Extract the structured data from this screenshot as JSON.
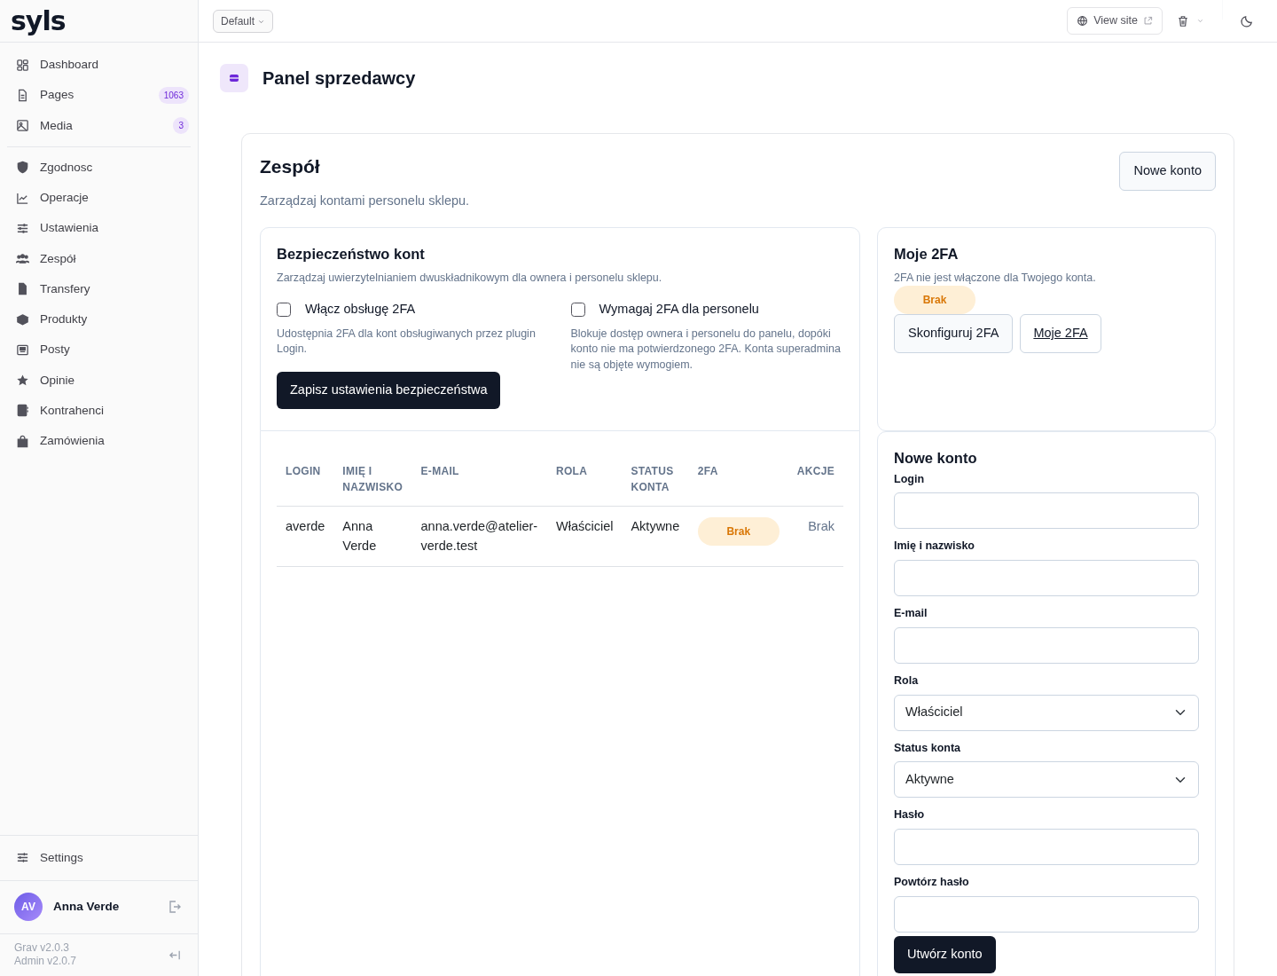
{
  "sidebar": {
    "logo": "syls",
    "items": [
      {
        "label": "Dashboard",
        "selected": false
      },
      {
        "label": "Pages",
        "badge": "1063",
        "selected": false
      },
      {
        "label": "Media",
        "badge": "3",
        "selected": false
      }
    ],
    "plugin_items": [
      {
        "label": "Zgodnosc"
      },
      {
        "label": "Operacje"
      },
      {
        "label": "Ustawienia"
      },
      {
        "label": "Zespół"
      },
      {
        "label": "Transfery"
      },
      {
        "label": "Produkty"
      },
      {
        "label": "Posty"
      },
      {
        "label": "Opinie"
      },
      {
        "label": "Kontrahenci"
      },
      {
        "label": "Zamówienia"
      }
    ],
    "settings": "Settings",
    "user": {
      "initials": "AV",
      "name": "Anna Verde"
    },
    "versions": [
      "Grav v2.0.3",
      "Admin v2.0.7"
    ]
  },
  "topbar": {
    "environment": "Default",
    "view_site": "View site"
  },
  "page": {
    "title": "Panel sprzedawcy"
  },
  "team": {
    "title": "Zespół",
    "subtitle": "Zarządzaj kontami personelu sklepu.",
    "new_button": "Nowe konto"
  },
  "security": {
    "title": "Bezpieczeństwo kont",
    "description": "Zarządzaj uwierzytelnianiem dwuskładnikowym dla ownera i personelu sklepu.",
    "options": [
      {
        "label": "Włącz obsługę 2FA",
        "checked": false,
        "help": "Udostępnia 2FA dla kont obsługiwanych przez plugin Login."
      },
      {
        "label": "Wymagaj 2FA dla personelu",
        "checked": false,
        "help": "Blokuje dostęp ownera i personelu do panelu, dopóki konto nie ma potwierdzonego 2FA. Konta superadmina nie są objęte wymogiem."
      }
    ],
    "save_button": "Zapisz ustawienia bezpieczeństwa"
  },
  "table": {
    "columns": [
      "LOGIN",
      "IMIĘ I NAZWISKO",
      "E-MAIL",
      "ROLA",
      "STATUS KONTA",
      "2FA",
      "AKCJE"
    ],
    "rows": [
      {
        "login": "averde",
        "name": "Anna Verde",
        "email": "anna.verde@atelier-verde.test",
        "role": "Właściciel",
        "status": "Aktywne",
        "twofa": "Brak",
        "actions": "Brak"
      }
    ]
  },
  "my2fa": {
    "title": "Moje 2FA",
    "text": "2FA nie jest włączone dla Twojego konta.",
    "badge": "Brak",
    "buttons": [
      {
        "label": "Skonfiguruj 2FA",
        "kind": "button"
      },
      {
        "label": "Moje 2FA",
        "kind": "link"
      }
    ]
  },
  "new_account": {
    "title": "Nowe konto",
    "fields": [
      {
        "label": "Login",
        "kind": "input"
      },
      {
        "label": "Imię i nazwisko",
        "kind": "input"
      },
      {
        "label": "E-mail",
        "kind": "input"
      },
      {
        "label": "Rola",
        "kind": "select",
        "value": "Właściciel"
      },
      {
        "label": "Status konta",
        "kind": "select",
        "value": "Aktywne"
      },
      {
        "label": "Hasło",
        "kind": "password"
      },
      {
        "label": "Powtórz hasło",
        "kind": "password"
      }
    ],
    "submit": "Utwórz konto"
  }
}
